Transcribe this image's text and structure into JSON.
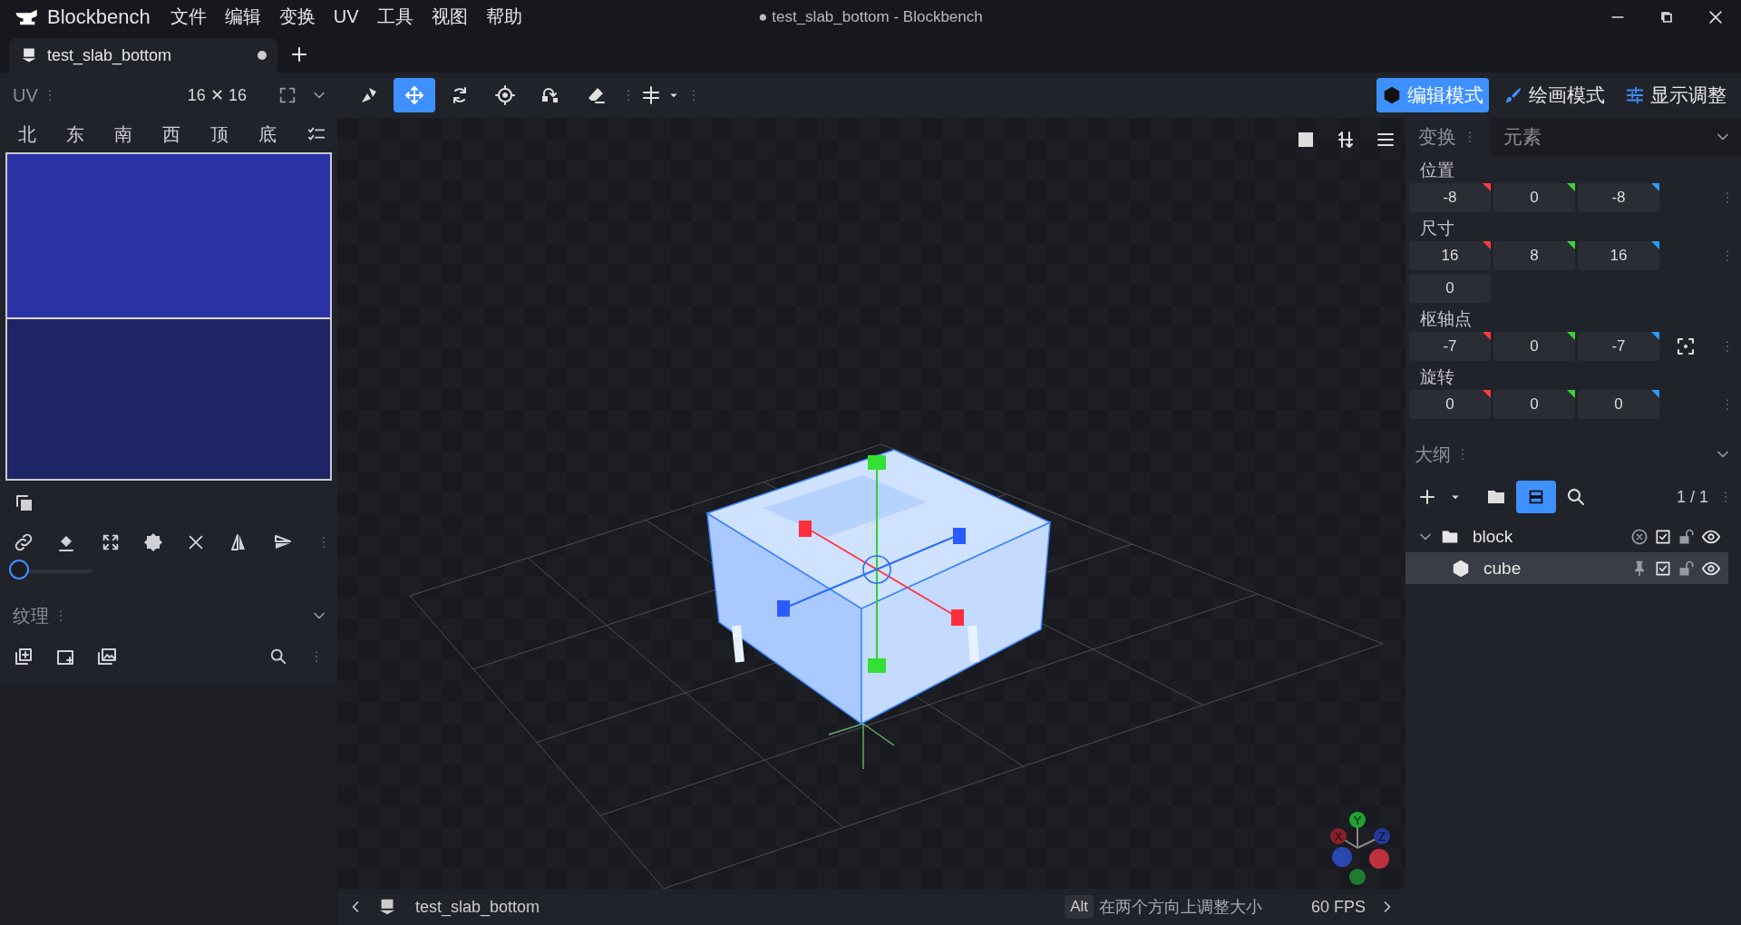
{
  "title_bar": {
    "app_name": "Blockbench",
    "menus": [
      "文件",
      "编辑",
      "变换",
      "UV",
      "工具",
      "视图",
      "帮助"
    ],
    "title": "● test_slab_bottom - Blockbench"
  },
  "tabs": [
    {
      "label": "test_slab_bottom",
      "unsaved": true,
      "selected": true
    }
  ],
  "uv_panel": {
    "title": "UV",
    "size": "16 ✕ 16",
    "faces": [
      "北",
      "东",
      "南",
      "西",
      "顶",
      "底"
    ],
    "zoom_slider": {
      "level": 0
    }
  },
  "textures_panel": {
    "title": "纹理"
  },
  "toolbar": {
    "tools": [
      {
        "kind": "shapes",
        "selected": false
      },
      {
        "kind": "move",
        "selected": true
      },
      {
        "kind": "rotate",
        "selected": false
      },
      {
        "kind": "crosshair",
        "selected": false
      },
      {
        "kind": "curved-arrow",
        "selected": false
      },
      {
        "kind": "eraser",
        "selected": false
      }
    ]
  },
  "modes": [
    {
      "label": "编辑模式",
      "kind": "edit",
      "selected": true
    },
    {
      "label": "绘画模式",
      "kind": "paint",
      "selected": false
    },
    {
      "label": "显示调整",
      "kind": "display",
      "selected": false
    }
  ],
  "viewport": {
    "axis_labels": [
      "X",
      "Y",
      "Z"
    ]
  },
  "status_bar": {
    "file": "test_slab_bottom",
    "key": "Alt",
    "hint": "在两个方向上调整大小",
    "fps": "60 FPS"
  },
  "properties": {
    "tabs": [
      {
        "label": "变换",
        "selected": true
      },
      {
        "label": "元素",
        "selected": false
      }
    ],
    "groups": [
      {
        "label": "位置",
        "kind": "vector",
        "values": [
          "-8",
          "0",
          "-8"
        ]
      },
      {
        "label": "尺寸",
        "kind": "vector",
        "values": [
          "16",
          "8",
          "16"
        ],
        "inflate": "0"
      },
      {
        "label": "枢轴点",
        "kind": "pivot",
        "values": [
          "-7",
          "0",
          "-7"
        ]
      },
      {
        "label": "旋转",
        "kind": "vector",
        "values": [
          "0",
          "0",
          "0"
        ]
      }
    ]
  },
  "outliner": {
    "title": "大纲",
    "count": "1 / 1",
    "tree": [
      {
        "name": "block",
        "kind": "group",
        "expanded": true,
        "checked": true,
        "selected": false,
        "children": [
          {
            "name": "cube",
            "kind": "cube",
            "checked": true,
            "selected": true
          }
        ]
      }
    ]
  }
}
